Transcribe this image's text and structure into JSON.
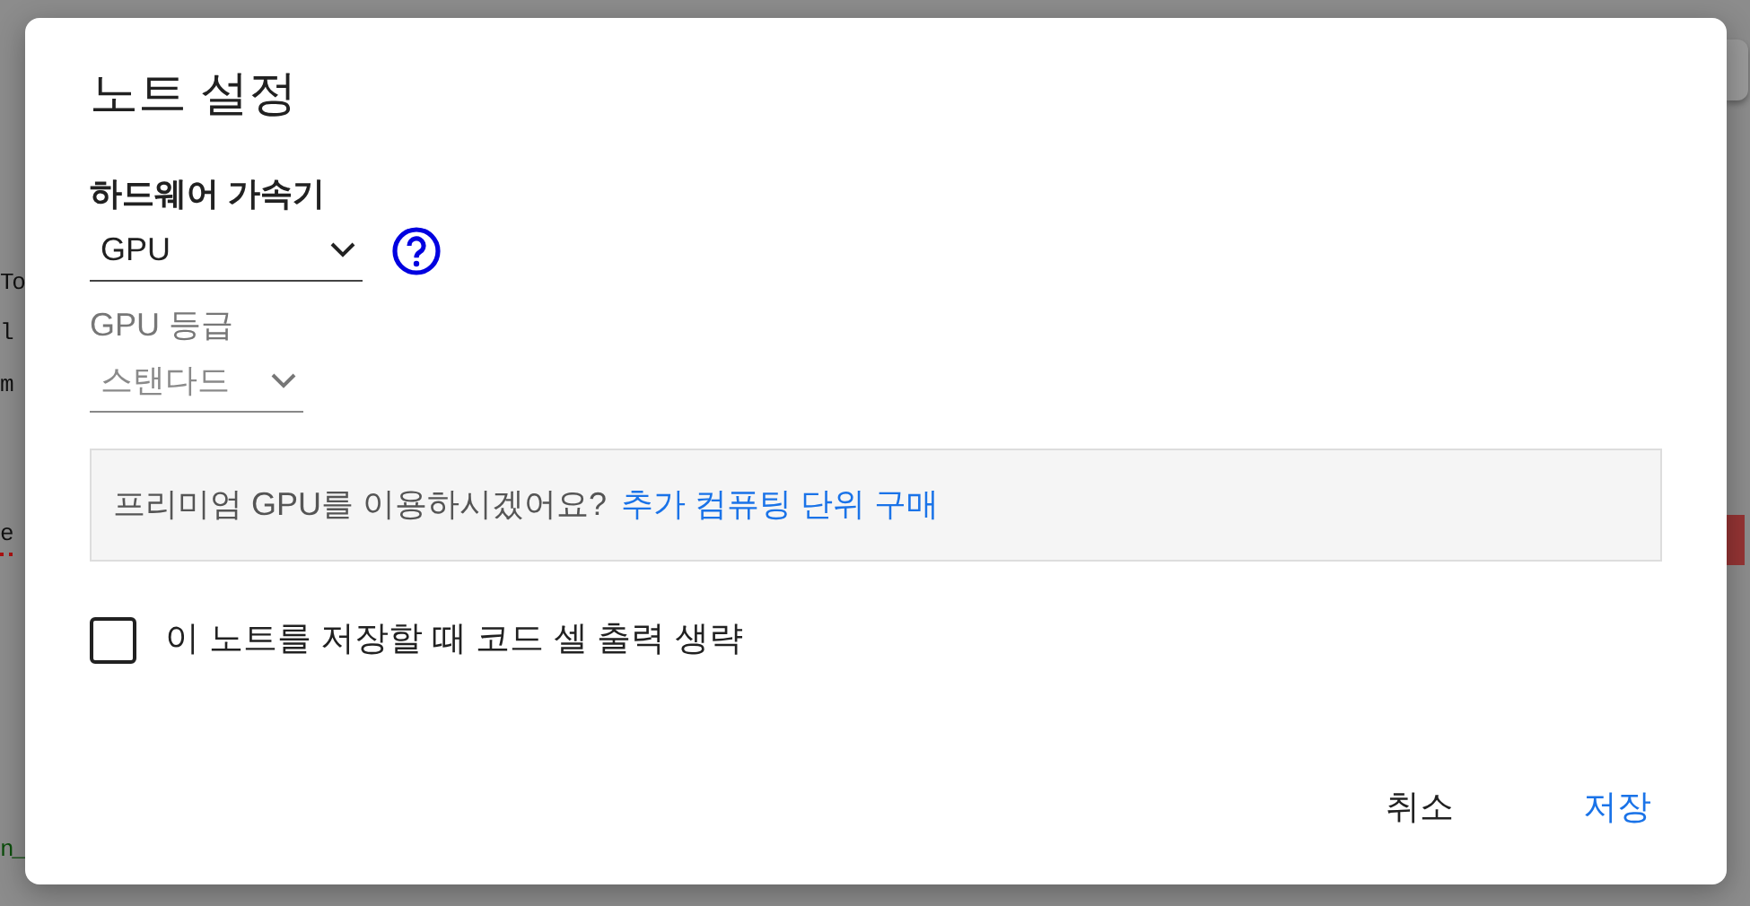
{
  "background": {
    "code_lines": [
      "To",
      "l",
      "m",
      "e",
      "n_"
    ]
  },
  "dialog": {
    "title": "노트 설정",
    "accelerator": {
      "label": "하드웨어 가속기",
      "value": "GPU",
      "disabled": false
    },
    "gpu_class": {
      "label": "GPU 등급",
      "value": "스탠다드",
      "disabled": true
    },
    "notice": {
      "text": "프리미엄 GPU를 이용하시겠어요?",
      "link": "추가 컴퓨팅 단위 구매"
    },
    "omit_output": {
      "label": "이 노트를 저장할 때 코드 셀 출력 생략",
      "checked": false
    },
    "buttons": [
      {
        "label": "취소",
        "kind": "secondary"
      },
      {
        "label": "저장",
        "kind": "primary"
      }
    ]
  }
}
